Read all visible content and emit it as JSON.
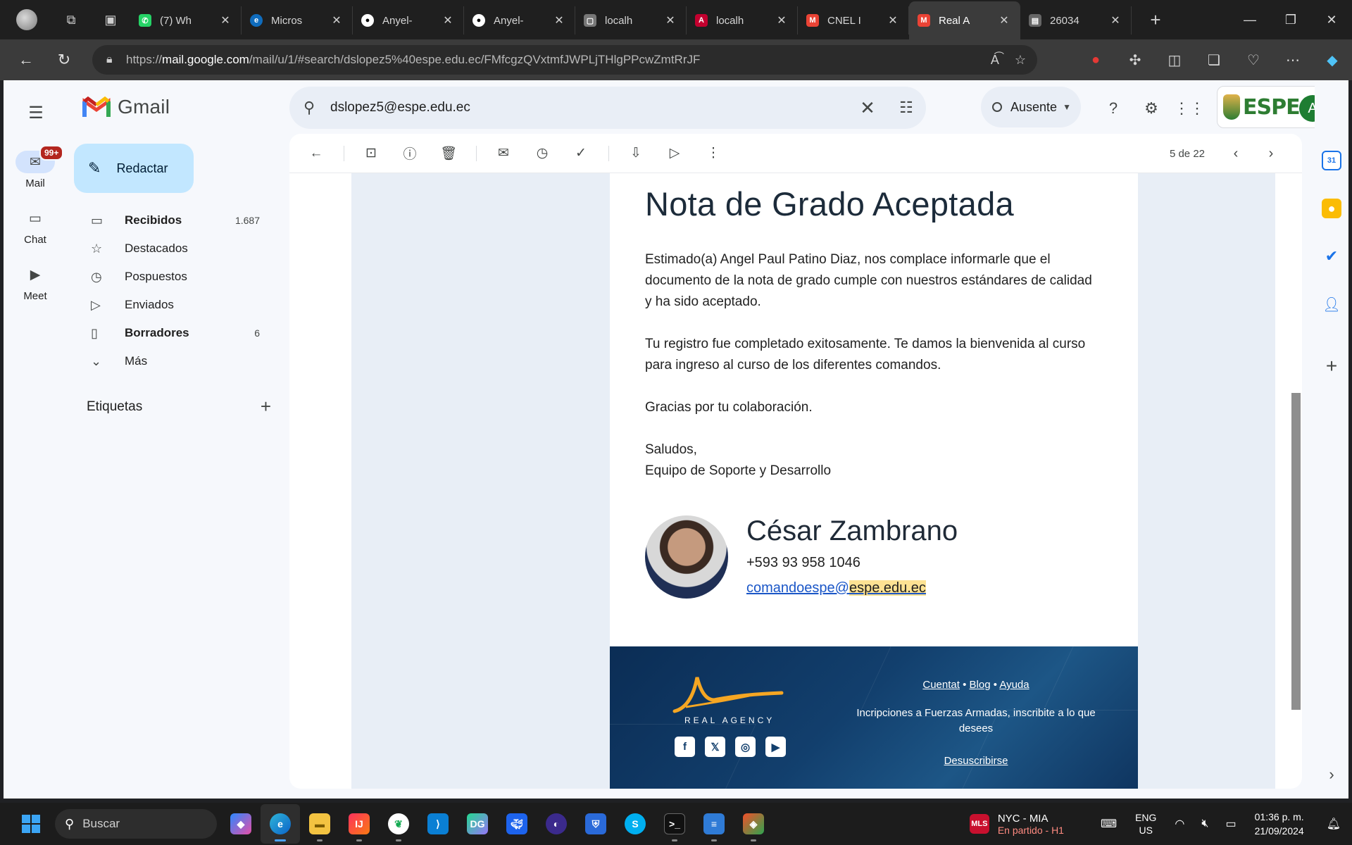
{
  "browser": {
    "tabs": [
      {
        "title": "",
        "favicon": "whatsapp",
        "color": "#25d366"
      },
      {
        "title": "(7) Wh",
        "favicon": "whatsapp",
        "color": "#25d366"
      },
      {
        "title": "Micros",
        "favicon": "edge",
        "color": "#1a73e8"
      },
      {
        "title": "Anyel-",
        "favicon": "github",
        "color": "#444"
      },
      {
        "title": "Anyel-",
        "favicon": "github",
        "color": "#444"
      },
      {
        "title": "localh",
        "favicon": "local",
        "color": "#555"
      },
      {
        "title": "localh",
        "favicon": "angular",
        "color": "#c3002f"
      },
      {
        "title": "CNEL I",
        "favicon": "gmail",
        "color": "#ea4335"
      },
      {
        "title": "Real A",
        "favicon": "gmail",
        "color": "#ea4335"
      },
      {
        "title": "26034",
        "favicon": "file",
        "color": "#777"
      }
    ],
    "url_prefix": "https://",
    "url_host": "mail.google.com",
    "url_rest": "/mail/u/1/#search/dslopez5%40espe.edu.ec/FMfcgzQVxtmfJWPLjTHlgPPcwZmtRrJF"
  },
  "gmail": {
    "brand": "Gmail",
    "rail": [
      {
        "label": "Mail",
        "badge": "99+"
      },
      {
        "label": "Chat"
      },
      {
        "label": "Meet"
      }
    ],
    "compose_label": "Redactar",
    "folders": [
      {
        "label": "Recibidos",
        "count": "1.687",
        "bold": true,
        "icon": "inbox-icon"
      },
      {
        "label": "Destacados",
        "count": "",
        "bold": false,
        "icon": "star-icon"
      },
      {
        "label": "Pospuestos",
        "count": "",
        "bold": false,
        "icon": "clock-icon"
      },
      {
        "label": "Enviados",
        "count": "",
        "bold": false,
        "icon": "send-icon"
      },
      {
        "label": "Borradores",
        "count": "6",
        "bold": true,
        "icon": "draft-icon"
      },
      {
        "label": "Más",
        "count": "",
        "bold": false,
        "icon": "chevron-down-icon"
      }
    ],
    "labels_title": "Etiquetas",
    "search_value": "dslopez5@espe.edu.ec",
    "status_label": "Ausente",
    "org_logo": "ESPE",
    "avatar_letter": "A",
    "pager_text": "5 de 22"
  },
  "email": {
    "heading": "Nota de Grado Aceptada",
    "para1": "Estimado(a) Angel Paul Patino Diaz, nos complace informarle que el documento de la nota de grado cumple con nuestros estándares de calidad y ha sido aceptado.",
    "para2": "Tu registro fue completado exitosamente. Te damos la bienvenida al curso para ingreso al curso de los diferentes comandos.",
    "para3": "Gracias por tu colaboración.",
    "closing": "Saludos,",
    "team": "Equipo de Soporte y Desarrollo",
    "sig_name": "César Zambrano",
    "sig_phone": "+593 93 958 1046",
    "sig_mail_user": "comandoespe@",
    "sig_mail_domain": "espe.edu.ec",
    "footer": {
      "agency": "REAL AGENCY",
      "link1": "Cuentat",
      "link2": "Blog",
      "link3": "Ayuda",
      "sep": "•",
      "pitch": "Incripciones a Fuerzas Armadas, inscribite a lo que desees",
      "unsubscribe": "Desuscribirse"
    }
  },
  "taskbar": {
    "search": "Buscar",
    "weather_title": "NYC - MIA",
    "weather_sub": "En partido - H1",
    "lang1": "ENG",
    "lang2": "US",
    "time": "01:36 p. m.",
    "date": "21/09/2024"
  }
}
